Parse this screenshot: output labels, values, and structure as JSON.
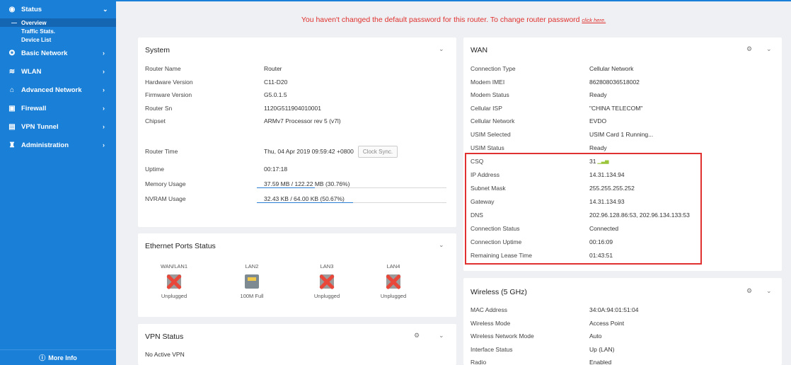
{
  "sidebar": {
    "items": [
      {
        "icon": "eye-icon",
        "label": "Status"
      },
      {
        "icon": "globe-icon",
        "label": "Basic Network"
      },
      {
        "icon": "wifi-icon",
        "label": "WLAN"
      },
      {
        "icon": "home-network-icon",
        "label": "Advanced Network"
      },
      {
        "icon": "firewall-icon",
        "label": "Firewall"
      },
      {
        "icon": "vpn-icon",
        "label": "VPN Tunnel"
      },
      {
        "icon": "admin-icon",
        "label": "Administration"
      }
    ],
    "status_subitems": [
      "Overview",
      "Traffic Stats.",
      "Device List"
    ],
    "more_info": "More Info"
  },
  "notice": {
    "text": "You haven't changed the default password for this router. To change router password",
    "link": "click here."
  },
  "system": {
    "title": "System",
    "rows": [
      {
        "k": "Router Name",
        "v": "Router"
      },
      {
        "k": "Hardware Version",
        "v": "C11-D20"
      },
      {
        "k": "Firmware Version",
        "v": "G5.0.1.5"
      },
      {
        "k": "Router Sn",
        "v": "1120G511904010001"
      },
      {
        "k": "Chipset",
        "v": "ARMv7 Processor rev 5 (v7l)"
      }
    ],
    "router_time_label": "Router Time",
    "router_time_value": "Thu, 04 Apr 2019 09:59:42 +0800",
    "clock_sync": "Clock Sync.",
    "uptime_label": "Uptime",
    "uptime_value": "00:17:18",
    "memory_label": "Memory Usage",
    "memory_value": "37.59 MB / 122.22 MB (30.76%)",
    "memory_percent": 30.76,
    "nvram_label": "NVRAM Usage",
    "nvram_value": "32.43 KB / 64.00 KB (50.67%)",
    "nvram_percent": 50.67
  },
  "ethernet": {
    "title": "Ethernet Ports Status",
    "ports": [
      {
        "name": "WAN/LAN1",
        "status": "Unplugged",
        "connected": false
      },
      {
        "name": "LAN2",
        "status": "100M Full",
        "connected": true
      },
      {
        "name": "LAN3",
        "status": "Unplugged",
        "connected": false
      },
      {
        "name": "LAN4",
        "status": "Unplugged",
        "connected": false
      }
    ]
  },
  "vpn": {
    "title": "VPN Status",
    "text": "No Active VPN"
  },
  "wan": {
    "title": "WAN",
    "rows": [
      {
        "k": "Connection Type",
        "v": "Cellular Network"
      },
      {
        "k": "Modem IMEI",
        "v": "862808036518002"
      },
      {
        "k": "Modem Status",
        "v": "Ready"
      },
      {
        "k": "Cellular ISP",
        "v": "\"CHINA TELECOM\""
      },
      {
        "k": "Cellular Network",
        "v": "EVDO"
      },
      {
        "k": "USIM Selected",
        "v": "USIM Card 1 Running..."
      },
      {
        "k": "USIM Status",
        "v": "Ready"
      },
      {
        "k": "CSQ",
        "v": "31"
      },
      {
        "k": "IP Address",
        "v": "14.31.134.94"
      },
      {
        "k": "Subnet Mask",
        "v": "255.255.255.252"
      },
      {
        "k": "Gateway",
        "v": "14.31.134.93"
      },
      {
        "k": "DNS",
        "v": "202.96.128.86:53, 202.96.134.133:53"
      },
      {
        "k": "Connection Status",
        "v": "Connected"
      },
      {
        "k": "Connection Uptime",
        "v": "00:16:09"
      },
      {
        "k": "Remaining Lease Time",
        "v": "01:43:51"
      }
    ]
  },
  "wireless": {
    "title": "Wireless (5 GHz)",
    "rows": [
      {
        "k": "MAC Address",
        "v": "34:0A:94:01:51:04"
      },
      {
        "k": "Wireless Mode",
        "v": "Access Point"
      },
      {
        "k": "Wireless Network Mode",
        "v": "Auto"
      },
      {
        "k": "Interface Status",
        "v": "Up (LAN)"
      },
      {
        "k": "Radio",
        "v": "Enabled"
      }
    ]
  }
}
